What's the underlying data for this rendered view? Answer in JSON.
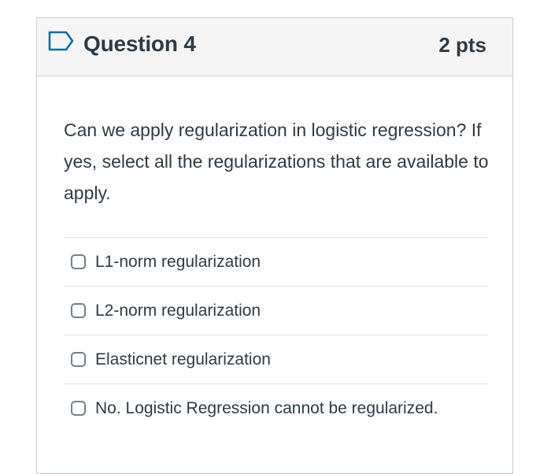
{
  "question": {
    "title": "Question 4",
    "points": "2 pts",
    "text": "Can we apply regularization in logistic regression? If yes, select all the regularizations that are available to apply."
  },
  "answers": [
    {
      "label": "L1-norm regularization",
      "checked": false
    },
    {
      "label": "L2-norm regularization",
      "checked": false
    },
    {
      "label": "Elasticnet regularization",
      "checked": false
    },
    {
      "label": "No. Logistic Regression cannot be regularized.",
      "checked": false
    }
  ],
  "colors": {
    "flag_icon": "#0770a3",
    "text": "#2d3b45",
    "header_bg": "#f5f5f5",
    "border": "#c7cdd1"
  },
  "icons": {
    "flag": "flag-question-icon",
    "checkbox": "checkbox-icon"
  }
}
